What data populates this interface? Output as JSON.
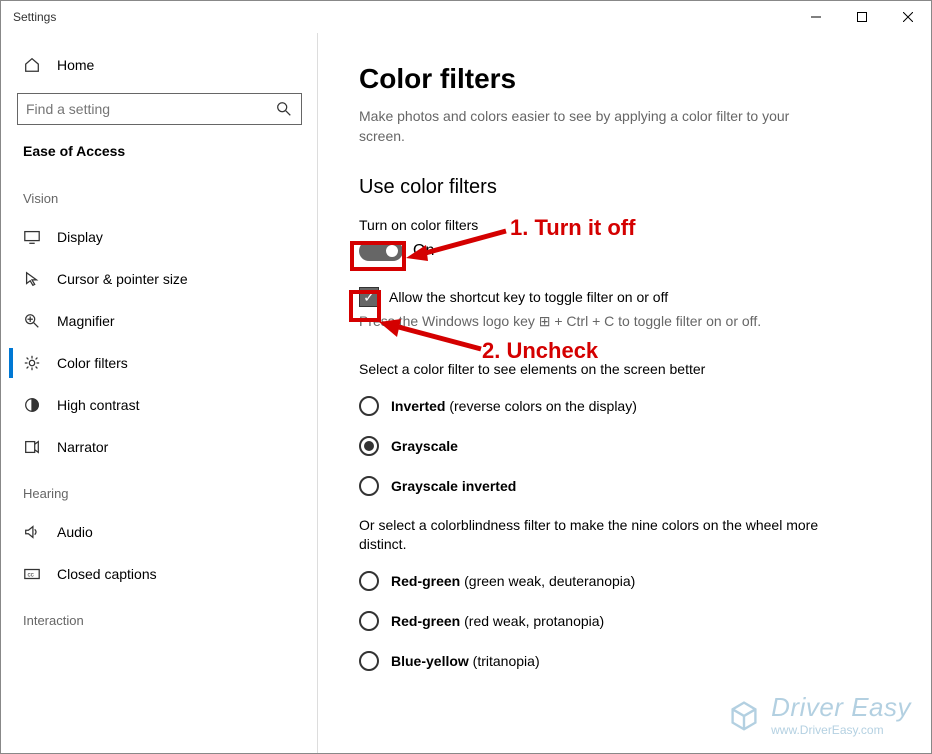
{
  "window": {
    "title": "Settings"
  },
  "sidebar": {
    "home": "Home",
    "search_placeholder": "Find a setting",
    "category": "Ease of Access",
    "groups": {
      "vision": {
        "label": "Vision",
        "items": [
          {
            "id": "display",
            "label": "Display"
          },
          {
            "id": "cursor",
            "label": "Cursor & pointer size"
          },
          {
            "id": "magnifier",
            "label": "Magnifier"
          },
          {
            "id": "colorfilters",
            "label": "Color filters",
            "selected": true
          },
          {
            "id": "highcontrast",
            "label": "High contrast"
          },
          {
            "id": "narrator",
            "label": "Narrator"
          }
        ]
      },
      "hearing": {
        "label": "Hearing",
        "items": [
          {
            "id": "audio",
            "label": "Audio"
          },
          {
            "id": "closedcaptions",
            "label": "Closed captions"
          }
        ]
      },
      "interaction": {
        "label": "Interaction"
      }
    }
  },
  "main": {
    "title": "Color filters",
    "subtitle": "Make photos and colors easier to see by applying a color filter to your screen.",
    "section1": "Use color filters",
    "toggle_label": "Turn on color filters",
    "toggle_state": "On",
    "checkbox_label": "Allow the shortcut key to toggle filter on or off",
    "shortcut_hint": "Press the Windows logo key ⊞ + Ctrl + C to toggle filter on or off.",
    "select_label": "Select a color filter to see elements on the screen better",
    "filters1": [
      {
        "bold": "Inverted",
        "paren": " (reverse colors on the display)",
        "selected": false
      },
      {
        "bold": "Grayscale",
        "paren": "",
        "selected": true
      },
      {
        "bold": "Grayscale inverted",
        "paren": "",
        "selected": false
      }
    ],
    "colorblind_label": "Or select a colorblindness filter to make the nine colors on the wheel more distinct.",
    "filters2": [
      {
        "bold": "Red-green",
        "paren": " (green weak, deuteranopia)"
      },
      {
        "bold": "Red-green",
        "paren": " (red weak, protanopia)"
      },
      {
        "bold": "Blue-yellow",
        "paren": " (tritanopia)"
      }
    ]
  },
  "annotations": {
    "step1": "1. Turn it off",
    "step2": "2. Uncheck"
  },
  "watermark": {
    "title": "Driver Easy",
    "url": "www.DriverEasy.com"
  }
}
